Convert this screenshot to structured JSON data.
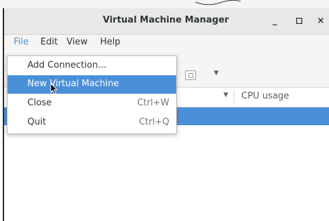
{
  "window": {
    "title": "Virtual Machine Manager",
    "controls": [
      "_",
      "□",
      "×"
    ]
  },
  "menubar": {
    "items": [
      "File",
      "Edit",
      "View",
      "Help"
    ],
    "active": "File"
  },
  "file_menu": {
    "items": [
      {
        "label": "Add Connection...",
        "shortcut": ""
      },
      {
        "label": "New Virtual Machine",
        "shortcut": ""
      },
      {
        "label": "Close",
        "shortcut": "Ctrl+W"
      },
      {
        "label": "Quit",
        "shortcut": "Ctrl+Q"
      }
    ],
    "highlighted": "New Virtual Machine"
  },
  "list": {
    "column_header": "CPU usage"
  },
  "colors": {
    "accent": "#4a90d9",
    "titlebar": "#e8e8e7",
    "menubar": "#f6f5f4"
  }
}
